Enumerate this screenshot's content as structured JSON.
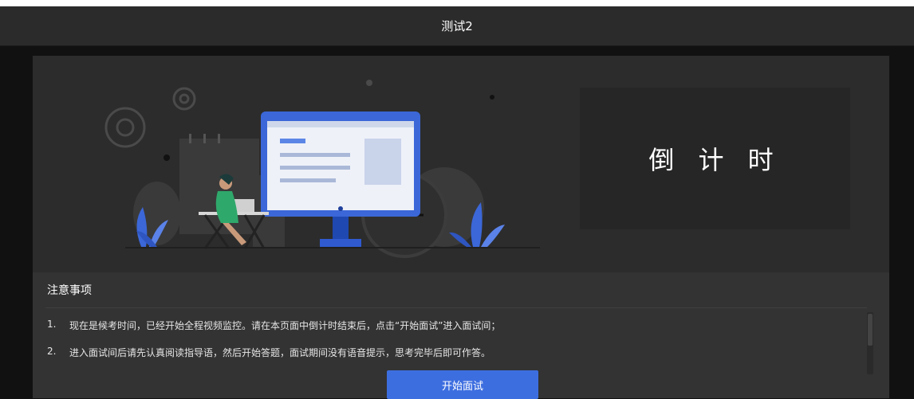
{
  "header": {
    "title": "测试2"
  },
  "countdown": {
    "label": "倒 计 时"
  },
  "notes": {
    "title": "注意事项",
    "items": [
      {
        "num": "1.",
        "text": "现在是候考时间，已经开始全程视频监控。请在本页面中倒计时结束后，点击“开始面试”进入面试间；"
      },
      {
        "num": "2.",
        "text": "进入面试间后请先认真阅读指导语，然后开始答题，面试期间没有语音提示，思考完毕后即可作答。"
      }
    ]
  },
  "actions": {
    "start_label": "开始面试"
  },
  "colors": {
    "accent": "#3d6ee0",
    "header_bg": "#2b2b2b",
    "panel_bg": "#2c2c2c",
    "notes_bg": "#333333"
  },
  "illustration": {
    "icons": [
      "gear-icon",
      "monitor-icon",
      "clock-icon",
      "calendar-icon",
      "plant-icon",
      "person-with-laptop"
    ]
  }
}
